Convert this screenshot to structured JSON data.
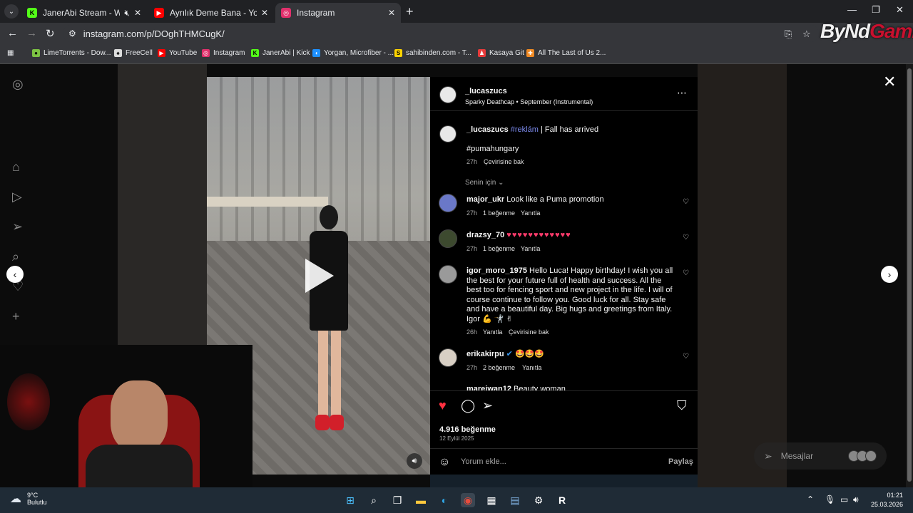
{
  "tabs": [
    {
      "title": "JanerAbi Stream - Watch Li",
      "fav_color": "#53fc18",
      "fav_letter": "K"
    },
    {
      "title": "Ayrılık Deme Bana - YouTube",
      "fav_color": "#ff0000",
      "fav_letter": "▶"
    },
    {
      "title": "Instagram",
      "fav_color": "#e1306c",
      "fav_letter": "◎"
    }
  ],
  "address": {
    "url": "instagram.com/p/DOghTHMCugK/"
  },
  "watermark": {
    "part1": "ByNd",
    "part2": "Gaming"
  },
  "bookmarks": [
    {
      "label": "LimeTorrents - Dow...",
      "color": "#7cc243",
      "letter": "●"
    },
    {
      "label": "FreeCell",
      "color": "#dddddd",
      "letter": "♠"
    },
    {
      "label": "YouTube",
      "color": "#ff0000",
      "letter": "▶"
    },
    {
      "label": "Instagram",
      "color": "#e1306c",
      "letter": "◎"
    },
    {
      "label": "JanerAbi | Kick",
      "color": "#53fc18",
      "letter": "K"
    },
    {
      "label": "Yorgan, Microfiber - ...",
      "color": "#1e90ff",
      "letter": "◖"
    },
    {
      "label": "sahibinden.com - T...",
      "color": "#ffd400",
      "letter": "S"
    },
    {
      "label": "Kasaya Git",
      "color": "#e83b3b",
      "letter": "♟"
    },
    {
      "label": "All The Last of Us 2...",
      "color": "#f08a24",
      "letter": "✚"
    }
  ],
  "post": {
    "author": "_lucaszucs",
    "audio": "Sparky Deathcap • September (Instrumental)",
    "caption_user": "_lucaszucs",
    "caption_tag": "#reklám",
    "caption_text": "| Fall has arrived",
    "caption_hashtag": "#pumahungary",
    "caption_time": "27h",
    "caption_translate": "Çevirisine bak",
    "sort_label": "Senin için",
    "likes": "4.916 beğenme",
    "date": "12 Eylül 2025",
    "comment_placeholder": "Yorum ekle...",
    "share_label": "Paylaş"
  },
  "comments": [
    {
      "user": "major_ukr",
      "text": "Look like a Puma promotion",
      "time": "27h",
      "likes": "1 beğenme",
      "reply": "Yanıtla"
    },
    {
      "user": "drazsy_70",
      "text": "♥♥♥♥♥♥♥♥♥♥♥♥",
      "time": "27h",
      "likes": "1 beğenme",
      "reply": "Yanıtla"
    },
    {
      "user": "igor_moro_1975",
      "text": "Hello Luca! Happy birthday! I wish you all the best for your future full of health and success. All the best too for fencing sport and new project in the life. I will of course continue to follow you. Good luck for all. Stay safe and have a beautiful day. Big hugs and greetings from Italy. Igor 💪 🤺 ✌",
      "time": "26h",
      "reply": "Yanıtla",
      "translate": "Çevirisine bak"
    },
    {
      "user": "erikakirpu",
      "text": "🤩🤩🤩",
      "time": "27h",
      "likes": "2 beğenme",
      "reply": "Yanıtla"
    },
    {
      "user": "mareiwan12",
      "text": "Beauty woman"
    }
  ],
  "messages_label": "Mesajlar",
  "taskbar": {
    "temp": "9°C",
    "condition": "Bulutlu",
    "time": "01:21",
    "date": "25.03.2026"
  }
}
